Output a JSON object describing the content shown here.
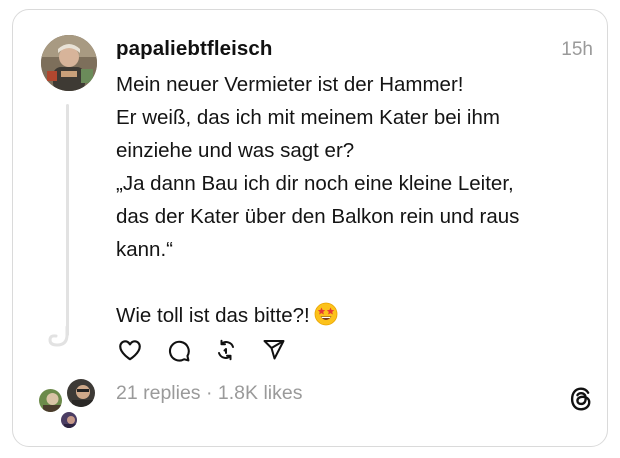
{
  "post": {
    "username": "papaliebtfleisch",
    "timestamp": "15h",
    "lines": [
      "Mein neuer Vermieter ist der Hammer!",
      "Er weiß, das ich mit meinem Kater bei ihm",
      "einziehe und was sagt er?",
      "„Ja dann Bau ich dir noch eine kleine Leiter,",
      "das der Kater über den Balkon rein und raus",
      "kann.“",
      "",
      "Wie toll ist das bitte?!"
    ],
    "emoji": "star-struck-emoji"
  },
  "stats": {
    "replies": "21 replies",
    "separator": "·",
    "likes": "1.8K likes"
  },
  "icons": {
    "like": "heart-icon",
    "reply": "comment-icon",
    "repost": "repost-icon",
    "share": "send-icon",
    "brand": "threads-logo-icon"
  }
}
